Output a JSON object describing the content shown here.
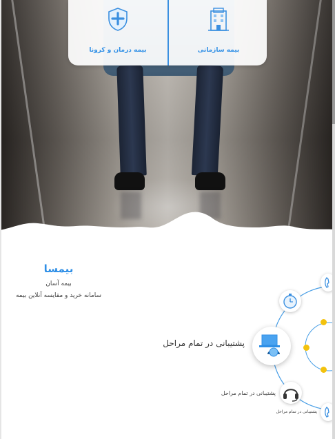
{
  "insurance_card": {
    "items": [
      {
        "label": "بیمه سازمانی",
        "icon": "building-icon"
      },
      {
        "label": "بیمه درمان و کرونا",
        "icon": "health-shield-icon"
      }
    ]
  },
  "brand": {
    "name": "بیمسا",
    "tagline": "بیمه آسان",
    "subtitle": "سامانه خرید و مقایسه آنلاین بیمه"
  },
  "features": {
    "main_label": "پشتیبانی در تمام مراحل",
    "secondary_label": "پشتیبانی در تمام مراحل",
    "tertiary_label": "پشتیبانی در تمام مراحل",
    "icons": [
      "stopwatch-icon",
      "laptop-support-icon",
      "headset-icon",
      "phone-icon"
    ]
  },
  "colors": {
    "accent": "#2f8fe6",
    "dot": "#f3c20d"
  }
}
